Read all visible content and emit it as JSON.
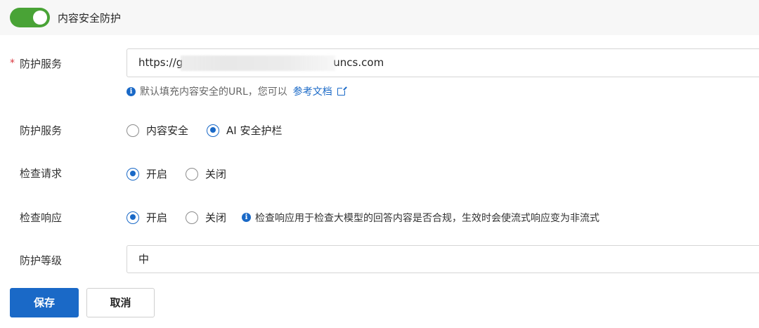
{
  "toggle": {
    "label": "内容安全防护",
    "state": "on",
    "color": "#49a336"
  },
  "service_url": {
    "label": "防护服务",
    "required_mark": "*",
    "value_prefix": "https://g",
    "value_suffix": "uncs.com",
    "hint_text": "默认填充内容安全的URL，您可以",
    "hint_link": "参考文档",
    "info_icon": "info-icon",
    "link_icon": "external-link-icon"
  },
  "service_type": {
    "label": "防护服务",
    "options": [
      "内容安全",
      "AI 安全护栏"
    ],
    "selected": "AI 安全护栏"
  },
  "check_request": {
    "label": "检查请求",
    "options": [
      "开启",
      "关闭"
    ],
    "selected": "开启"
  },
  "check_response": {
    "label": "检查响应",
    "options": [
      "开启",
      "关闭"
    ],
    "selected": "开启",
    "hint": "检查响应用于检查大模型的回答内容是否合规，生效时会使流式响应变为非流式"
  },
  "protection_level": {
    "label": "防护等级",
    "value": "中"
  },
  "actions": {
    "save": "保存",
    "cancel": "取消"
  },
  "colors": {
    "primary": "#1a69c7",
    "required": "#d9363e"
  }
}
